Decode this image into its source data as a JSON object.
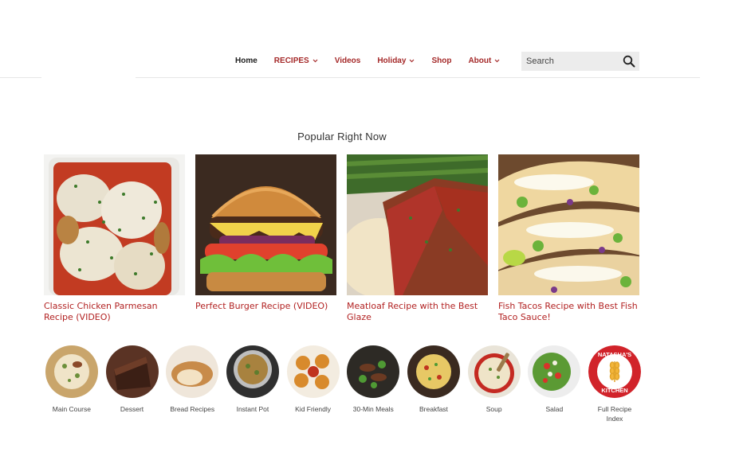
{
  "nav": {
    "items": [
      {
        "label": "Home"
      },
      {
        "label": "RECIPES",
        "chevron": true
      },
      {
        "label": "Videos"
      },
      {
        "label": "Holiday",
        "chevron": true
      },
      {
        "label": "Shop"
      },
      {
        "label": "About",
        "chevron": true
      }
    ],
    "search_placeholder": "Search",
    "colors": {
      "accent": "#a52a2a",
      "home": "#222222"
    }
  },
  "popular": {
    "heading": "Popular Right Now",
    "cards": [
      {
        "title": "Classic Chicken Parmesan Recipe (VIDEO)",
        "image": "chicken-parmesan-photo"
      },
      {
        "title": "Perfect Burger Recipe (VIDEO)",
        "image": "burger-photo"
      },
      {
        "title": "Meatloaf Recipe with the Best Glaze",
        "image": "meatloaf-photo"
      },
      {
        "title": "Fish Tacos Recipe with Best Fish Taco Sauce!",
        "image": "fish-tacos-photo"
      }
    ]
  },
  "categories": [
    {
      "label": "Main Course"
    },
    {
      "label": "Dessert"
    },
    {
      "label": "Bread Recipes"
    },
    {
      "label": "Instant Pot"
    },
    {
      "label": "Kid Friendly"
    },
    {
      "label": "30-Min Meals"
    },
    {
      "label": "Breakfast"
    },
    {
      "label": "Soup"
    },
    {
      "label": "Salad"
    },
    {
      "label": "Full Recipe Index",
      "logo_text": [
        "NATASHA'S",
        "KITCHEN"
      ]
    }
  ]
}
